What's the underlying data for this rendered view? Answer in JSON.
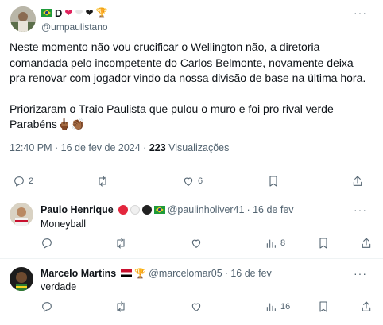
{
  "tweet": {
    "display_name": "D",
    "handle": "@umpaulistano",
    "text_lines": [
      "Neste momento não vou crucificar o Wellington não, a diretoria",
      "comandada pelo incompetente do Carlos Belmonte, novamente deixa",
      "pra renovar com jogador vindo da nossa divisão de base na última hora."
    ],
    "text2_lines": [
      "Priorizaram o Traio Paulista que pulou o muro e foi pro rival verde",
      "Parabéns"
    ],
    "emojis": "🖕🏾👏🏾",
    "time": "12:40 PM · 16 de fev de 2024 · ",
    "views_count": "223",
    "views_label": " Visualizações",
    "reply_count": "2",
    "like_count": "6",
    "colors": {
      "text": "#0f1419",
      "muted": "#536471",
      "divider": "#eff3f4"
    }
  },
  "replies": [
    {
      "name": "Paulo Henrique",
      "handle": "@paulinholiver41",
      "date": "· 16 de fev",
      "text": "Moneyball",
      "views": "8"
    },
    {
      "name": "Marcelo Martins",
      "handle": "@marcelomar05",
      "date": "· 16 de fev",
      "text": "verdade",
      "views": "16"
    }
  ]
}
